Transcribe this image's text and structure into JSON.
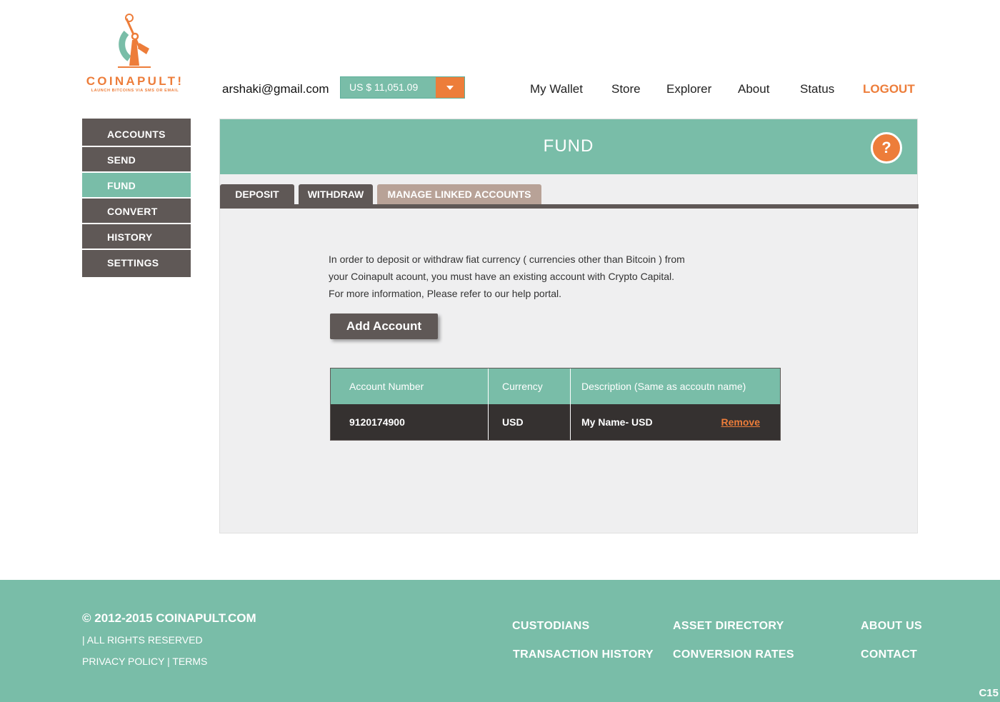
{
  "brand": {
    "name": "COINAPULT!",
    "tagline": "LAUNCH BITCOINS VIA SMS OR EMAIL"
  },
  "header": {
    "user_email": "arshaki@gmail.com",
    "balance": "US $ 11,051.09",
    "nav": [
      "My Wallet",
      "Store",
      "Explorer",
      "About",
      "Status"
    ],
    "logout": "LOGOUT"
  },
  "sidebar": {
    "items": [
      {
        "label": "ACCOUNTS"
      },
      {
        "label": "SEND"
      },
      {
        "label": "FUND",
        "active": true
      },
      {
        "label": "CONVERT"
      },
      {
        "label": "HISTORY"
      },
      {
        "label": "SETTINGS"
      }
    ]
  },
  "main": {
    "title": "FUND",
    "help": "?",
    "tabs": [
      "DEPOSIT",
      "WITHDRAW",
      "MANAGE LINKED ACCOUNTS"
    ],
    "info_text": "In order to deposit or withdraw fiat currency ( currencies other than Bitcoin ) from your Coinapult acount, you must have an existing account with Crypto Capital. For more information, Please refer to our help portal.",
    "add_button": "Add Account",
    "table": {
      "headers": [
        "Account Number",
        "Currency",
        "Description  (Same as accoutn name)"
      ],
      "rows": [
        {
          "account": "9120174900",
          "currency": "USD",
          "description": "My Name- USD",
          "action": "Remove"
        }
      ]
    }
  },
  "footer": {
    "copyright": "© 2012-2015 COINAPULT.COM",
    "rights": "| ALL RIGHTS RESERVED",
    "privacy": "PRIVACY POLICY",
    "separator": "|",
    "terms": "TERMS",
    "links": [
      "CUSTODIANS",
      "ASSET DIRECTORY",
      "ABOUT US",
      "TRANSACTION HISTORY",
      "CONVERSION RATES",
      "CONTACT"
    ],
    "code": "C15"
  },
  "colors": {
    "accent_green": "#79bda8",
    "accent_orange": "#ed7d3a",
    "dark_brown": "#5f5856",
    "taupe": "#b8a297"
  }
}
